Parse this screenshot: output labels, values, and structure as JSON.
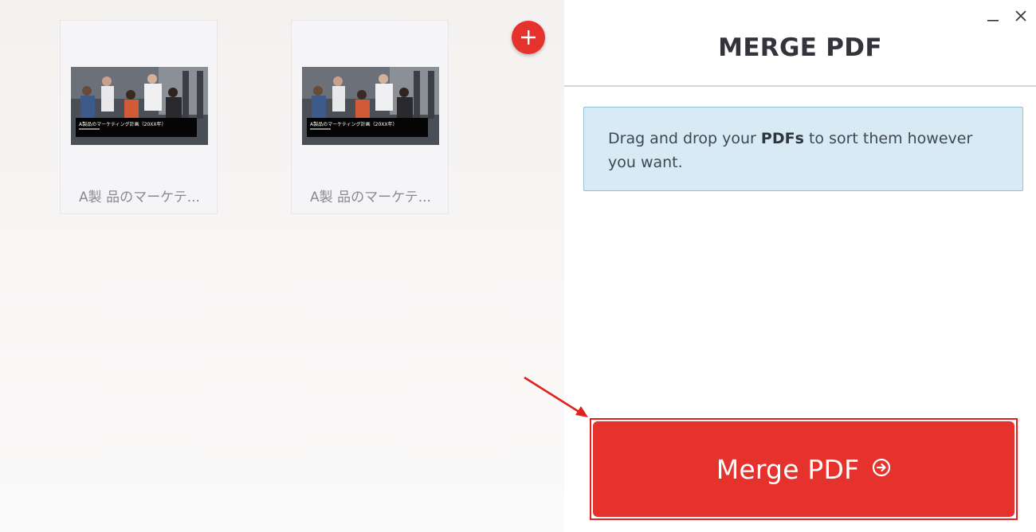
{
  "files": [
    {
      "name": "A製 品のマーケテ...",
      "thumbnail_title": "A製品のマーケティング計画（20XX年）"
    },
    {
      "name": "A製 品のマーケテ...",
      "thumbnail_title": "A製品のマーケティング計画（20XX年）"
    }
  ],
  "toolbar": {
    "add_icon": "plus-icon"
  },
  "window_controls": {
    "minimize_icon": "minimize-icon",
    "close_icon": "close-icon"
  },
  "sidebar": {
    "title": "MERGE PDF",
    "info_pre": "Drag and drop your ",
    "info_bold": "PDFs",
    "info_post": " to sort them however you want."
  },
  "action": {
    "label": "Merge PDF",
    "icon": "arrow-circle-right-icon"
  },
  "colors": {
    "accent": "#e5322d",
    "info_bg": "#d8ebf5",
    "info_border": "#93bfd8",
    "annotation": "#e2201e"
  }
}
